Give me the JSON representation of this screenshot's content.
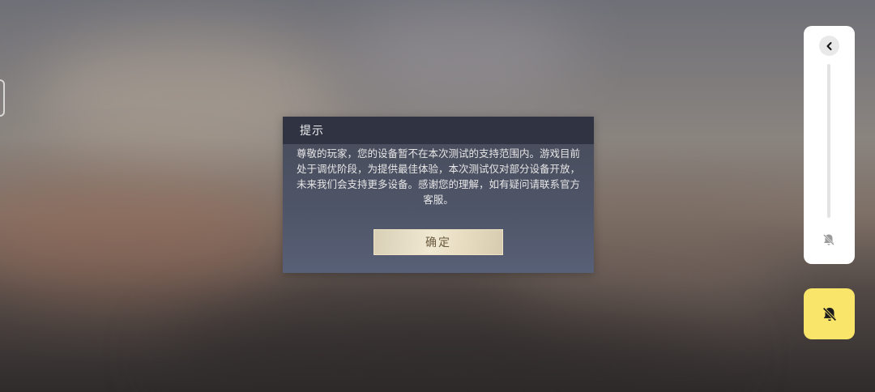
{
  "dialog": {
    "title": "提示",
    "message": "尊敬的玩家，您的设备暂不在本次测试的支持范围内。游戏目前处于调优阶段，为提供最佳体验，本次测试仅对部分设备开放，未来我们会支持更多设备。感谢您的理解，如有疑问请联系官方客服。",
    "confirm_label": "确定"
  },
  "side_panel": {
    "collapse_icon": "chevron-left-icon",
    "mute_icon": "bell-off-icon"
  },
  "notify_button": {
    "icon": "bell-off-icon",
    "color": "#f9e56a"
  }
}
